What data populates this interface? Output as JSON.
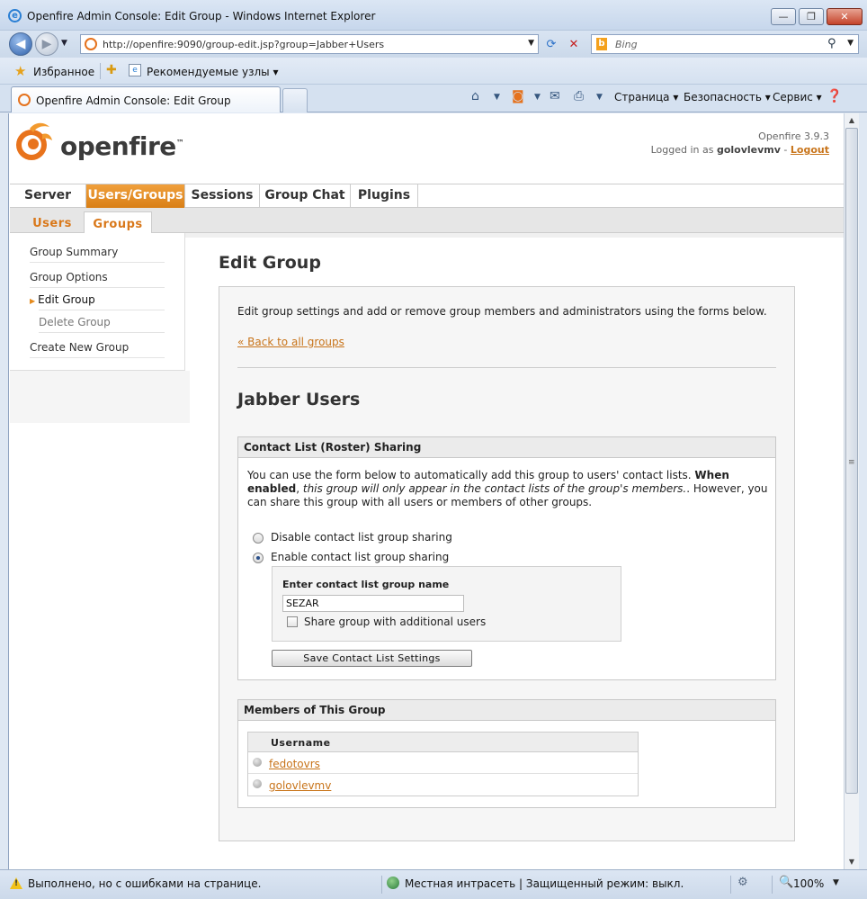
{
  "window": {
    "title": "Openfire Admin Console: Edit Group - Windows Internet Explorer",
    "min": "—",
    "max": "❐",
    "close": "✕"
  },
  "address": {
    "url": "http://openfire:9090/group-edit.jsp?group=Jabber+Users",
    "search_placeholder": "Bing"
  },
  "favorites": {
    "label": "Избранное",
    "suggested": "Рекомендуемые узлы ▾"
  },
  "tab": {
    "label": "Openfire Admin Console: Edit Group"
  },
  "commands": {
    "page": "Страница ▾",
    "safety": "Безопасность ▾",
    "tools": "Сервис ▾"
  },
  "header": {
    "logo_text": "openfire",
    "logo_mark": "™",
    "version": "Openfire 3.9.3",
    "logged_in_prefix": "Logged in as",
    "username": "golovlevmv",
    "dash": "-",
    "logout": "Logout"
  },
  "main_tabs": [
    {
      "label": "Server"
    },
    {
      "label": "Users/Groups"
    },
    {
      "label": "Sessions"
    },
    {
      "label": "Group Chat"
    },
    {
      "label": "Plugins"
    }
  ],
  "sub_tabs": [
    {
      "label": "Users"
    },
    {
      "label": "Groups"
    }
  ],
  "sidebar": {
    "items": [
      {
        "label": "Group Summary"
      },
      {
        "label": "Group Options"
      },
      {
        "label": "Edit Group"
      },
      {
        "label": "Delete Group"
      },
      {
        "label": "Create New Group"
      }
    ]
  },
  "content": {
    "title": "Edit Group",
    "intro": "Edit group settings and add or remove group members and administrators using the forms below.",
    "back_link": "« Back to all groups",
    "group_name": "Jabber Users"
  },
  "roster": {
    "heading": "Contact List (Roster) Sharing",
    "desc_1": "You can use the form below to automatically add this group to users' contact lists. ",
    "desc_bold": "When enabled",
    "desc_comma": ", ",
    "desc_italic": "this group will only appear in the contact lists of the group's members.",
    "desc_2": ". However, you can share this group with all users or members of other groups.",
    "option_disable": "Disable contact list group sharing",
    "option_enable": "Enable contact list group sharing",
    "selected": "enable",
    "group_name_label": "Enter contact list group name",
    "group_name_value": "SEZAR",
    "share_label": "Share group with additional users",
    "share_checked": false,
    "save_label": "Save Contact List Settings"
  },
  "members": {
    "heading": "Members of This Group",
    "column_username": "Username",
    "rows": [
      {
        "username": "fedotovrs"
      },
      {
        "username": "golovlevmv"
      }
    ]
  },
  "status": {
    "text": "Выполнено, но с ошибками на странице.",
    "zone": "Местная интрасеть | Защищенный режим: выкл.",
    "zoom": "100%"
  },
  "colors": {
    "accent": "#d97f16",
    "link": "#c8741a"
  }
}
